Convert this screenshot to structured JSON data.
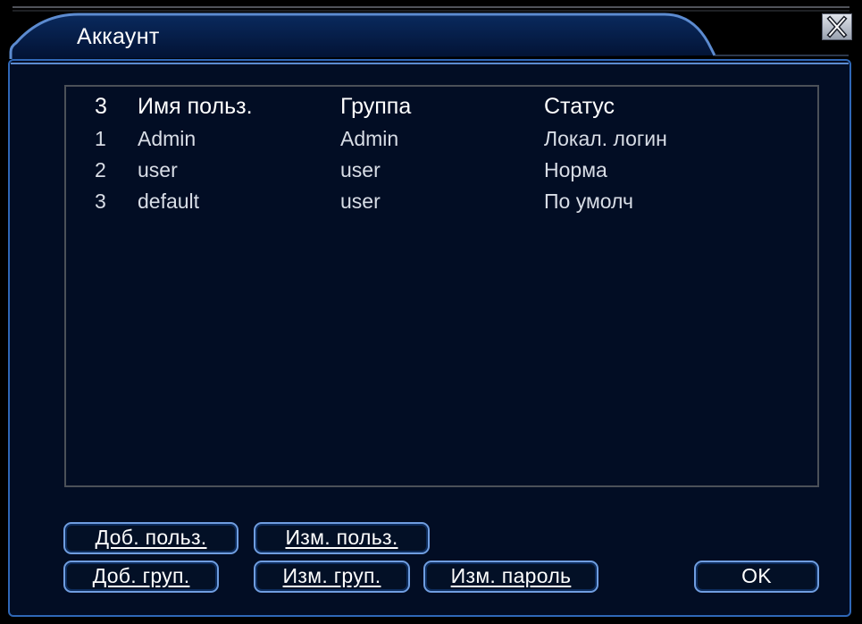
{
  "window": {
    "title": "Аккаунт",
    "close_glyph": "✕"
  },
  "table": {
    "header": {
      "count": "3",
      "user": "Имя польз.",
      "group": "Группа",
      "status": "Статус"
    },
    "rows": [
      {
        "num": "1",
        "user": "Admin",
        "group": "Admin",
        "status": "Локал. логин"
      },
      {
        "num": "2",
        "user": "user",
        "group": "user",
        "status": "Норма"
      },
      {
        "num": "3",
        "user": "default",
        "group": "user",
        "status": "По умолч"
      }
    ]
  },
  "buttons": {
    "add_user": "Доб. польз.",
    "edit_user": "Изм. польз.",
    "add_group": "Доб. груп.",
    "edit_group": "Изм. груп.",
    "change_password": "Изм. пароль",
    "ok": "OK"
  },
  "colors": {
    "background": "#020d24",
    "border": "#2f67b6",
    "button_border": "#6f9de0"
  }
}
